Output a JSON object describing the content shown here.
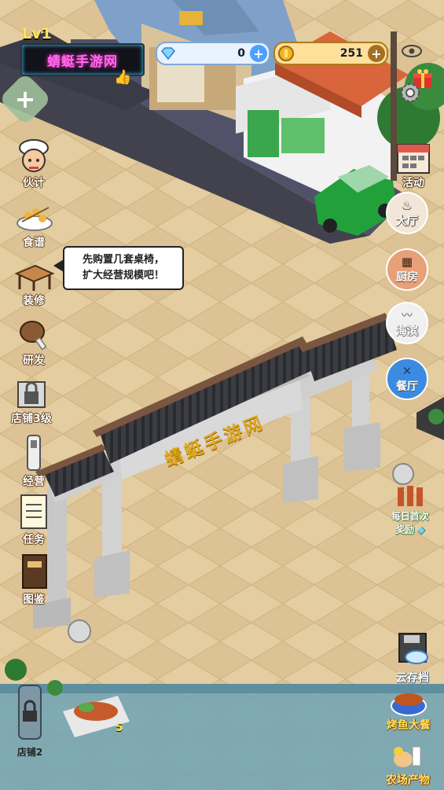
{
  "hud": {
    "level": "Lv1",
    "sign_text": "蜻蜓手游网",
    "diamonds": "0",
    "coins": "251"
  },
  "gate_sign": "蜻蜓手游网",
  "speech_bubble": {
    "line1": "先购置几套桌椅，",
    "line2": "扩大经营规模吧！"
  },
  "left_menu": [
    {
      "label": "伙计"
    },
    {
      "label": "食谱"
    },
    {
      "label": "装修"
    },
    {
      "label": "研发"
    },
    {
      "label": "店铺3级"
    },
    {
      "label": "经营"
    },
    {
      "label": "任务"
    },
    {
      "label": "图鉴"
    }
  ],
  "right_menu": [
    {
      "label": "活动"
    },
    {
      "label": "大厅"
    },
    {
      "label": "厨房"
    },
    {
      "label": "海滨"
    },
    {
      "label": "餐厅"
    }
  ],
  "daily_reward": {
    "line1": "每日首次",
    "line2": "奖励"
  },
  "cloud_save": "云存档",
  "bottom": {
    "shop2": "店铺2",
    "dish_count": "5",
    "grill_feast": "烤鱼大餐",
    "farm_products": "农场产物"
  },
  "colors": {
    "ground": "#e0c99c",
    "neon_pink": "#ff6aea",
    "gold": "#ffe35a",
    "water": "#6fa3b5"
  },
  "icons": [
    "diamond-icon",
    "coin-icon",
    "settings-icon",
    "eye-icon",
    "gift-icon",
    "calendar-icon"
  ]
}
